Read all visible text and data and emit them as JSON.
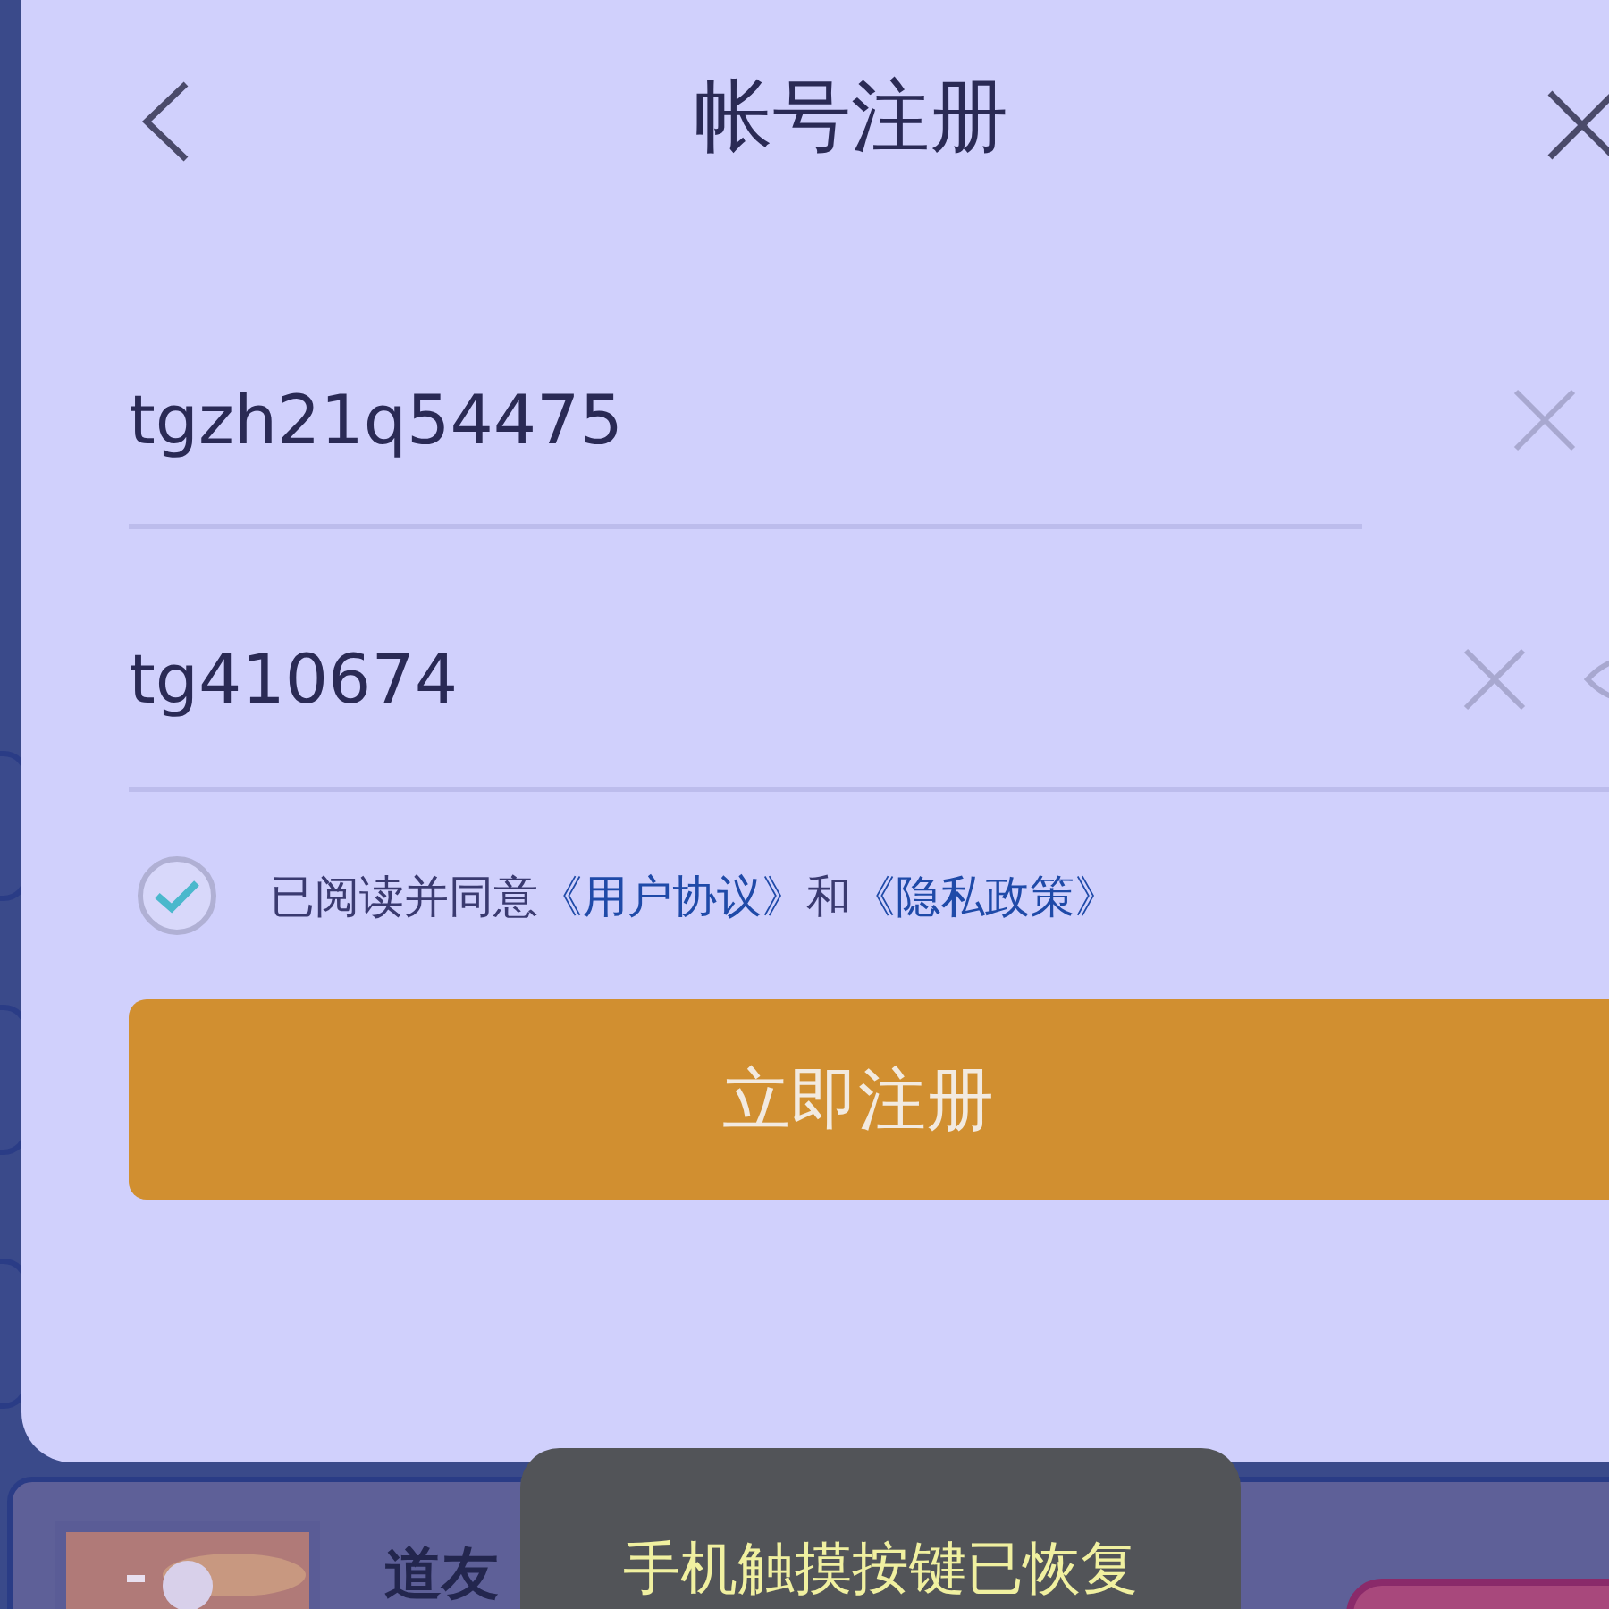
{
  "header": {
    "title": "帐号注册"
  },
  "fields": [
    {
      "kind": "text",
      "value": "tgzh21q54475"
    },
    {
      "kind": "password",
      "value": "tg410674"
    }
  ],
  "agreement": {
    "checked": true,
    "parts": [
      {
        "kind": "text",
        "text": "已阅读并同意"
      },
      {
        "kind": "link",
        "text": "《用户协议》"
      },
      {
        "kind": "text",
        "text": "和"
      },
      {
        "kind": "link",
        "text": "《隐私政策》"
      }
    ]
  },
  "register_button": {
    "label": "立即注册"
  },
  "background_card": {
    "title": "道友"
  },
  "toast": {
    "text": "手机触摸按键已恢复"
  }
}
